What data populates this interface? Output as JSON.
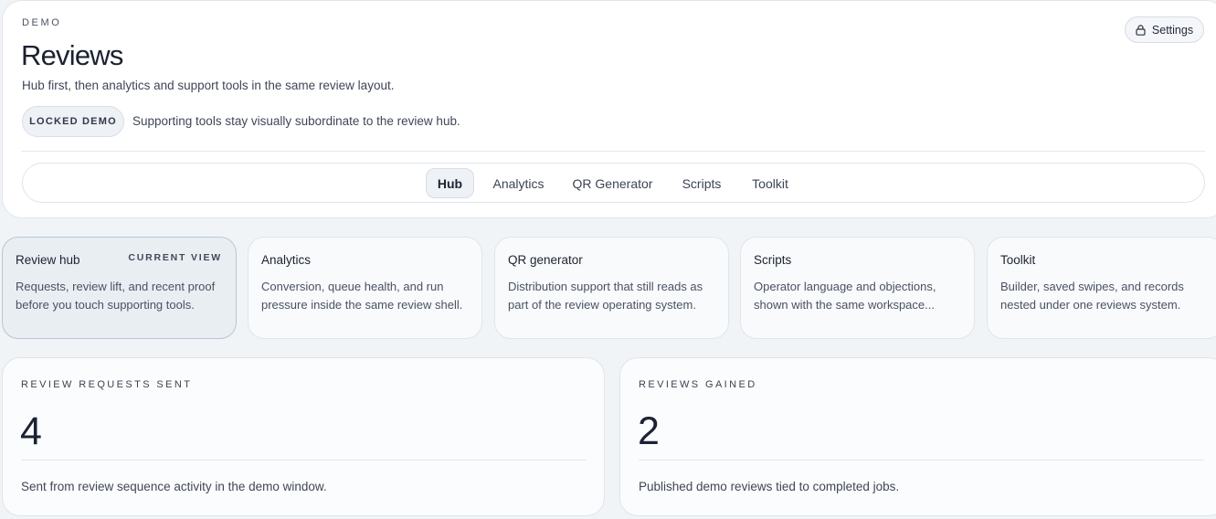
{
  "header": {
    "eyebrow": "DEMO",
    "title": "Reviews",
    "subtitle": "Hub first, then analytics and support tools in the same review layout.",
    "locked_badge": "LOCKED DEMO",
    "locked_note": "Supporting tools stay visually subordinate to the review hub.",
    "settings_label": "Settings",
    "settings_icon": "lock-icon"
  },
  "tabs": [
    {
      "label": "Hub",
      "active": true
    },
    {
      "label": "Analytics",
      "active": false
    },
    {
      "label": "QR Generator",
      "active": false
    },
    {
      "label": "Scripts",
      "active": false
    },
    {
      "label": "Toolkit",
      "active": false
    }
  ],
  "nav_cards": [
    {
      "title": "Review hub",
      "badge": "CURRENT VIEW",
      "line1": "Requests, review lift, and recent proof",
      "line2": "before you touch supporting tools."
    },
    {
      "title": "Analytics",
      "badge": "",
      "line1": "Conversion, queue health, and run",
      "line2": "pressure inside the same review shell."
    },
    {
      "title": "QR generator",
      "badge": "",
      "line1": "Distribution support that still reads as",
      "line2": "part of the review operating system."
    },
    {
      "title": "Scripts",
      "badge": "",
      "line1": "Operator language and objections,",
      "line2": "shown with the same workspace..."
    },
    {
      "title": "Toolkit",
      "badge": "",
      "line1": "Builder, saved swipes, and records",
      "line2": "nested under one reviews system."
    }
  ],
  "metrics": [
    {
      "label": "REVIEW REQUESTS SENT",
      "value": "4",
      "note": "Sent from review sequence activity in the demo window."
    },
    {
      "label": "REVIEWS GAINED",
      "value": "2",
      "note": "Published demo reviews tied to completed jobs."
    }
  ],
  "colors": {
    "page_bg": "#f1f4f7",
    "card_bg": "#ffffff",
    "text_primary": "#1b2130",
    "text_secondary": "#3f4656",
    "current_card_bg": "#e9eef3",
    "current_card_border": "#b9c6d3"
  }
}
